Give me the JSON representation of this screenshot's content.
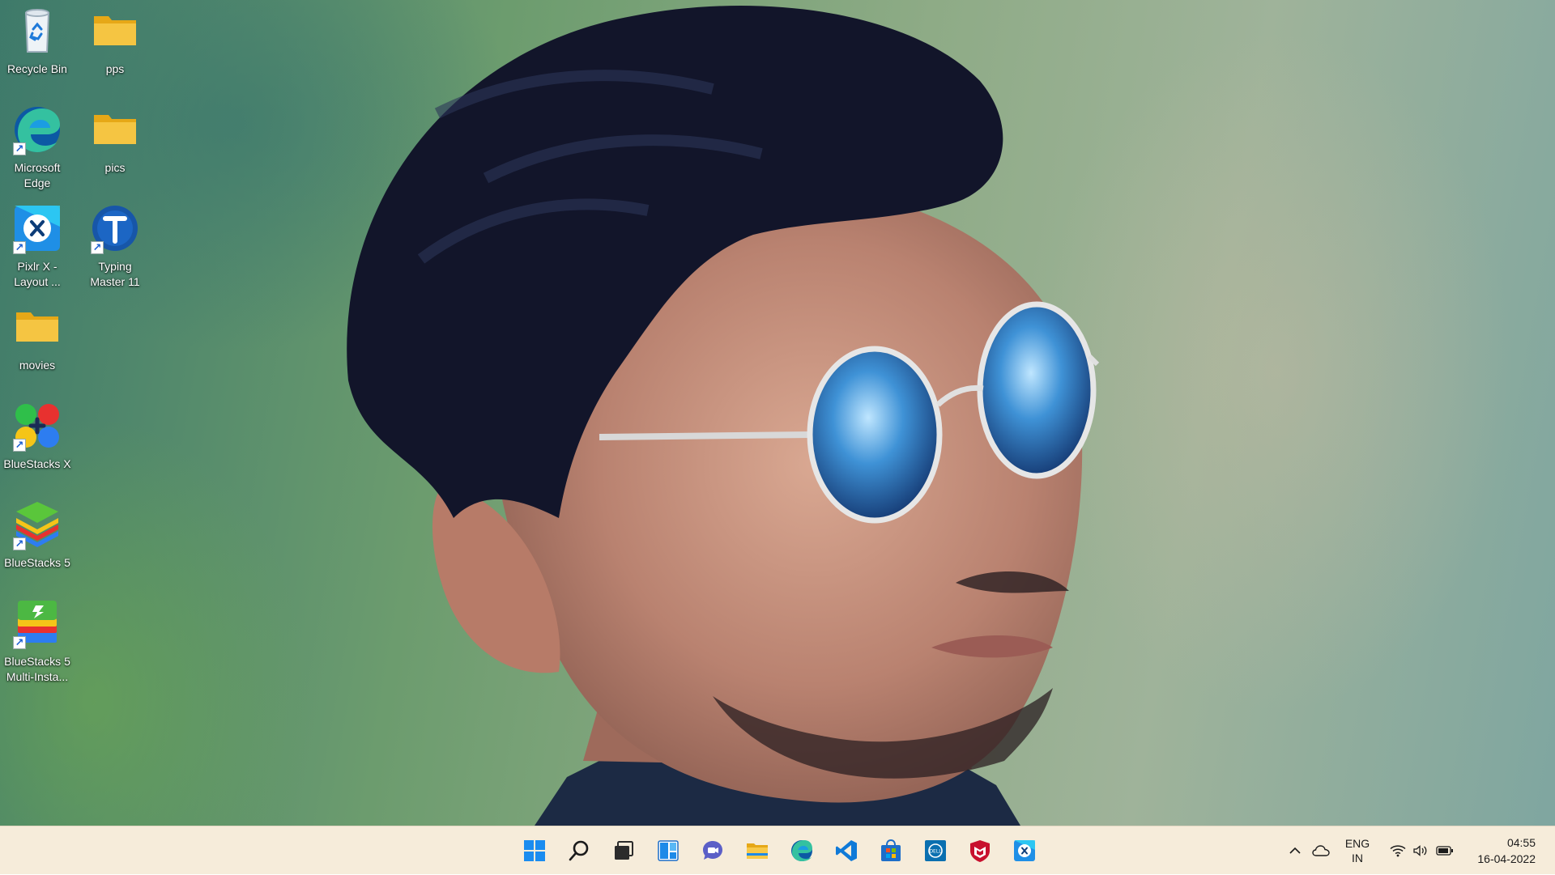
{
  "desktop": {
    "icons": [
      {
        "label": "Recycle Bin",
        "icon": "recycle-bin-icon"
      },
      {
        "label": "pps",
        "icon": "folder-icon"
      },
      {
        "label": "Microsoft Edge",
        "icon": "edge-icon"
      },
      {
        "label": "pics",
        "icon": "folder-icon"
      },
      {
        "label": "Pixlr X - Layout ...",
        "icon": "pixlr-icon"
      },
      {
        "label": "Typing Master 11",
        "icon": "typing-master-icon"
      },
      {
        "label": "movies",
        "icon": "folder-icon"
      },
      {
        "label": "BlueStacks X",
        "icon": "bluestacks-x-icon"
      },
      {
        "label": "BlueStacks 5",
        "icon": "bluestacks-5-icon"
      },
      {
        "label": "BlueStacks 5 Multi-Insta...",
        "icon": "bluestacks-multi-instance-icon"
      }
    ]
  },
  "taskbar": {
    "pinned": [
      "start-icon",
      "search-icon",
      "task-view-icon",
      "widgets-icon",
      "chat-icon",
      "file-explorer-icon",
      "edge-icon",
      "vscode-icon",
      "microsoft-store-icon",
      "dell-icon",
      "mcafee-icon",
      "pixlr-icon"
    ],
    "tray": {
      "language_line1": "ENG",
      "language_line2": "IN",
      "time": "04:55",
      "date": "16-04-2022"
    }
  },
  "colors": {
    "taskbar_bg": "#f6ecda",
    "folder_yellow": "#f5c542",
    "accent_blue": "#0f6cbd"
  }
}
